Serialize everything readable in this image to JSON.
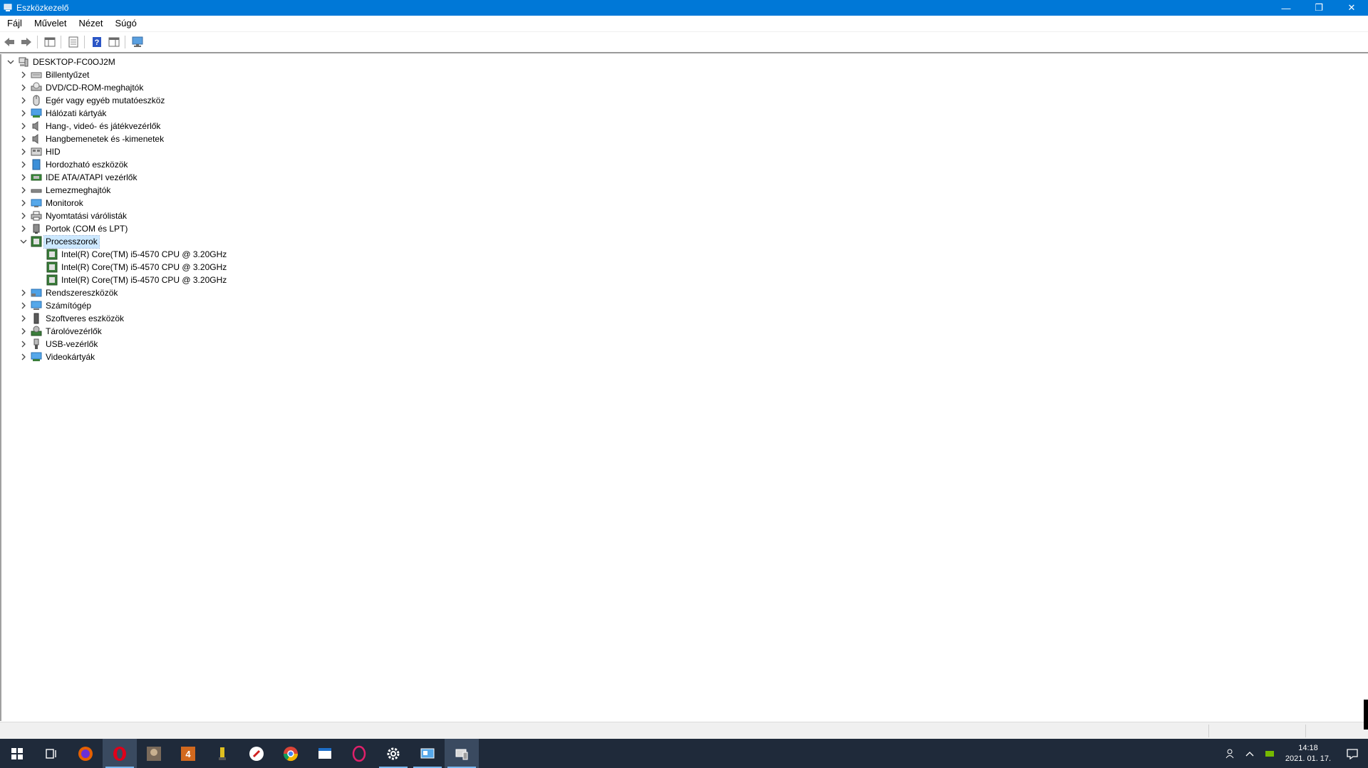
{
  "window": {
    "title": "Eszközkezelő",
    "controls": {
      "minimize": "—",
      "maximize": "❐",
      "close": "✕"
    }
  },
  "menu": {
    "items": [
      "Fájl",
      "Művelet",
      "Nézet",
      "Súgó"
    ]
  },
  "toolbar": {
    "buttons": [
      "back-icon",
      "forward-icon",
      "show-hide-tree-icon",
      "properties-icon",
      "help-icon",
      "action-pane-icon",
      "scan-hardware-icon"
    ]
  },
  "tree": {
    "root": "DESKTOP-FC0OJ2M",
    "categories": [
      {
        "label": "Billentyűzet",
        "icon": "keyboard-icon"
      },
      {
        "label": "DVD/CD-ROM-meghajtók",
        "icon": "dvd-drive-icon"
      },
      {
        "label": "Egér vagy egyéb mutatóeszköz",
        "icon": "mouse-icon"
      },
      {
        "label": "Hálózati kártyák",
        "icon": "network-adapter-icon"
      },
      {
        "label": "Hang-, videó- és játékvezérlők",
        "icon": "speaker-icon"
      },
      {
        "label": "Hangbemenetek és -kimenetek",
        "icon": "audio-io-icon"
      },
      {
        "label": "HID",
        "icon": "hid-icon"
      },
      {
        "label": "Hordozható eszközök",
        "icon": "portable-device-icon"
      },
      {
        "label": "IDE ATA/ATAPI vezérlők",
        "icon": "ide-controller-icon"
      },
      {
        "label": "Lemezmeghajtók",
        "icon": "disk-drive-icon"
      },
      {
        "label": "Monitorok",
        "icon": "monitor-icon"
      },
      {
        "label": "Nyomtatási várólisták",
        "icon": "printer-icon"
      },
      {
        "label": "Portok (COM és LPT)",
        "icon": "port-icon"
      },
      {
        "label": "Processzorok",
        "icon": "processor-icon",
        "expanded": true,
        "selected": true,
        "children": [
          "Intel(R) Core(TM) i5-4570 CPU @ 3.20GHz",
          "Intel(R) Core(TM) i5-4570 CPU @ 3.20GHz",
          "Intel(R) Core(TM) i5-4570 CPU @ 3.20GHz"
        ]
      },
      {
        "label": "Rendszereszközök",
        "icon": "system-device-icon"
      },
      {
        "label": "Számítógép",
        "icon": "computer-icon"
      },
      {
        "label": "Szoftveres eszközök",
        "icon": "software-device-icon"
      },
      {
        "label": "Tárolóvezérlők",
        "icon": "storage-controller-icon"
      },
      {
        "label": "USB-vezérlők",
        "icon": "usb-icon"
      },
      {
        "label": "Videokártyák",
        "icon": "display-adapter-icon"
      }
    ]
  },
  "taskbar": {
    "apps": [
      "start-icon",
      "task-view-icon",
      "firefox-icon",
      "opera-icon",
      "game-icon-1",
      "game-icon-2",
      "game-icon-3",
      "game-icon-4",
      "chrome-icon",
      "explorer-icon",
      "opera-gx-icon",
      "settings-icon",
      "control-panel-icon",
      "device-manager-icon"
    ],
    "clock": {
      "time": "14:18",
      "date": "2021. 01. 17."
    }
  },
  "colors": {
    "titlebar": "#0078d7",
    "taskbar": "#1f2a3a",
    "selection": "#cce8ff"
  }
}
